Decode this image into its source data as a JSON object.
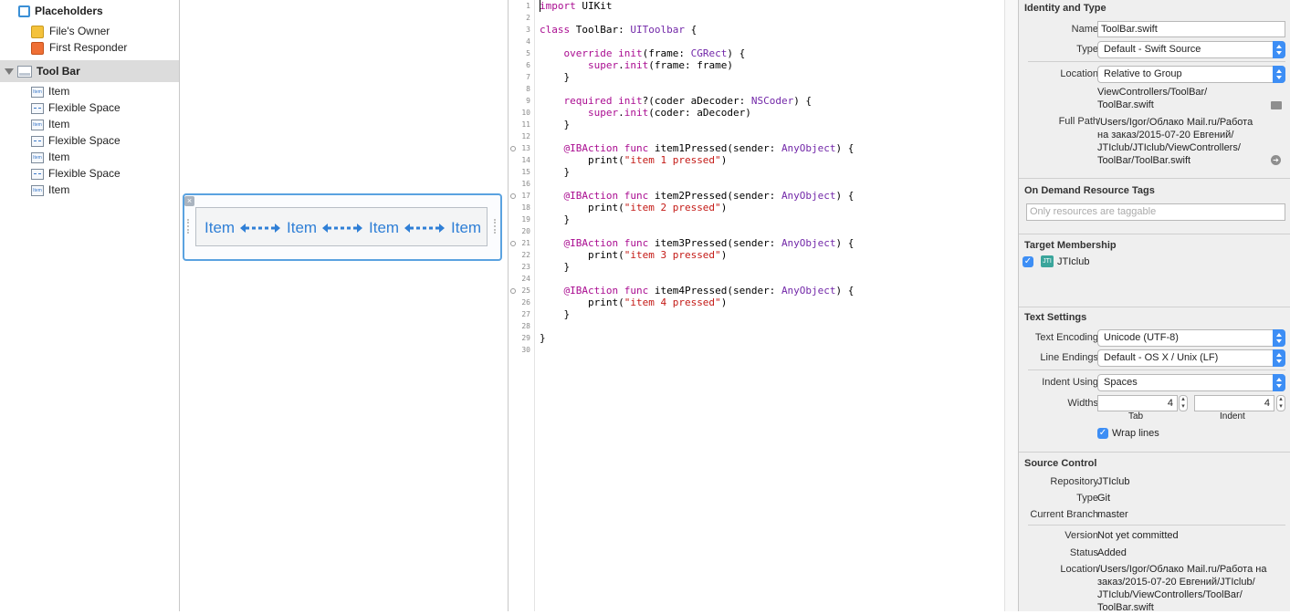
{
  "outline": {
    "placeholders_label": "Placeholders",
    "files_owner_label": "File's Owner",
    "first_responder_label": "First Responder",
    "toolbar_label": "Tool Bar",
    "children": [
      {
        "kind": "item",
        "label": "Item"
      },
      {
        "kind": "flex",
        "label": "Flexible Space"
      },
      {
        "kind": "item",
        "label": "Item"
      },
      {
        "kind": "flex",
        "label": "Flexible Space"
      },
      {
        "kind": "item",
        "label": "Item"
      },
      {
        "kind": "flex",
        "label": "Flexible Space"
      },
      {
        "kind": "item",
        "label": "Item"
      }
    ],
    "item_icon_text": "Item"
  },
  "canvas": {
    "items": [
      "Item",
      "Item",
      "Item",
      "Item"
    ],
    "close_glyph": "×"
  },
  "editor": {
    "line_numbers": [
      "1",
      "2",
      "3",
      "4",
      "5",
      "6",
      "7",
      "8",
      "9",
      "10",
      "11",
      "12",
      "13",
      "14",
      "15",
      "16",
      "17",
      "18",
      "19",
      "20",
      "21",
      "22",
      "23",
      "24",
      "25",
      "26",
      "27",
      "28",
      "29",
      "30"
    ],
    "breakpoint_lines": [
      13,
      17,
      21,
      25
    ],
    "lines": [
      [
        {
          "t": "import",
          "c": "kw"
        },
        {
          "t": " UIKit"
        }
      ],
      [],
      [
        {
          "t": "class",
          "c": "kw"
        },
        {
          "t": " ToolBar: "
        },
        {
          "t": "UIToolbar",
          "c": "ty"
        },
        {
          "t": " {"
        }
      ],
      [],
      [
        {
          "t": "    "
        },
        {
          "t": "override",
          "c": "kw"
        },
        {
          "t": " "
        },
        {
          "t": "init",
          "c": "kw"
        },
        {
          "t": "(frame: "
        },
        {
          "t": "CGRect",
          "c": "ty"
        },
        {
          "t": ") {"
        }
      ],
      [
        {
          "t": "        "
        },
        {
          "t": "super",
          "c": "kw"
        },
        {
          "t": "."
        },
        {
          "t": "init",
          "c": "kw"
        },
        {
          "t": "(frame: frame)"
        }
      ],
      [
        {
          "t": "    }"
        }
      ],
      [],
      [
        {
          "t": "    "
        },
        {
          "t": "required",
          "c": "kw"
        },
        {
          "t": " "
        },
        {
          "t": "init",
          "c": "kw"
        },
        {
          "t": "?(coder aDecoder: "
        },
        {
          "t": "NSCoder",
          "c": "ty"
        },
        {
          "t": ") {"
        }
      ],
      [
        {
          "t": "        "
        },
        {
          "t": "super",
          "c": "kw"
        },
        {
          "t": "."
        },
        {
          "t": "init",
          "c": "kw"
        },
        {
          "t": "(coder: aDecoder)"
        }
      ],
      [
        {
          "t": "    }"
        }
      ],
      [],
      [
        {
          "t": "    "
        },
        {
          "t": "@IBAction",
          "c": "kw"
        },
        {
          "t": " "
        },
        {
          "t": "func",
          "c": "kw"
        },
        {
          "t": " item1Pressed(sender: "
        },
        {
          "t": "AnyObject",
          "c": "ty"
        },
        {
          "t": ") {"
        }
      ],
      [
        {
          "t": "        print("
        },
        {
          "t": "\"item 1 pressed\"",
          "c": "st"
        },
        {
          "t": ")"
        }
      ],
      [
        {
          "t": "    }"
        }
      ],
      [],
      [
        {
          "t": "    "
        },
        {
          "t": "@IBAction",
          "c": "kw"
        },
        {
          "t": " "
        },
        {
          "t": "func",
          "c": "kw"
        },
        {
          "t": " item2Pressed(sender: "
        },
        {
          "t": "AnyObject",
          "c": "ty"
        },
        {
          "t": ") {"
        }
      ],
      [
        {
          "t": "        print("
        },
        {
          "t": "\"item 2 pressed\"",
          "c": "st"
        },
        {
          "t": ")"
        }
      ],
      [
        {
          "t": "    }"
        }
      ],
      [],
      [
        {
          "t": "    "
        },
        {
          "t": "@IBAction",
          "c": "kw"
        },
        {
          "t": " "
        },
        {
          "t": "func",
          "c": "kw"
        },
        {
          "t": " item3Pressed(sender: "
        },
        {
          "t": "AnyObject",
          "c": "ty"
        },
        {
          "t": ") {"
        }
      ],
      [
        {
          "t": "        print("
        },
        {
          "t": "\"item 3 pressed\"",
          "c": "st"
        },
        {
          "t": ")"
        }
      ],
      [
        {
          "t": "    }"
        }
      ],
      [],
      [
        {
          "t": "    "
        },
        {
          "t": "@IBAction",
          "c": "kw"
        },
        {
          "t": " "
        },
        {
          "t": "func",
          "c": "kw"
        },
        {
          "t": " item4Pressed(sender: "
        },
        {
          "t": "AnyObject",
          "c": "ty"
        },
        {
          "t": ") {"
        }
      ],
      [
        {
          "t": "        print("
        },
        {
          "t": "\"item 4 pressed\"",
          "c": "st"
        },
        {
          "t": ")"
        }
      ],
      [
        {
          "t": "    }"
        }
      ],
      [],
      [
        {
          "t": "}"
        }
      ],
      []
    ]
  },
  "inspector": {
    "identity": {
      "title": "Identity and Type",
      "name_label": "Name",
      "name_value": "ToolBar.swift",
      "type_label": "Type",
      "type_value": "Default - Swift Source",
      "location_label": "Location",
      "location_value": "Relative to Group",
      "path_line1": "ViewControllers/ToolBar/",
      "path_line2": "ToolBar.swift",
      "fullpath_label": "Full Path",
      "fullpath_lines": [
        "/Users/Igor/Облако Mail.ru/Работа",
        "на заказ/2015-07-20 Евгений/",
        "JTIclub/JTIclub/ViewControllers/",
        "ToolBar/ToolBar.swift"
      ]
    },
    "on_demand": {
      "title": "On Demand Resource Tags",
      "placeholder": "Only resources are taggable"
    },
    "target": {
      "title": "Target Membership",
      "app_name": "JTIclub",
      "checked_glyph": "✓"
    },
    "text_settings": {
      "title": "Text Settings",
      "encoding_label": "Text Encoding",
      "encoding_value": "Unicode (UTF-8)",
      "endings_label": "Line Endings",
      "endings_value": "Default - OS X / Unix (LF)",
      "indent_label": "Indent Using",
      "indent_value": "Spaces",
      "widths_label": "Widths",
      "tab_value": "4",
      "indent_width_value": "4",
      "tab_caption": "Tab",
      "indent_caption": "Indent",
      "wrap_label": "Wrap lines"
    },
    "source_control": {
      "title": "Source Control",
      "repository_label": "Repository",
      "repository_value": "JTIclub",
      "type_label": "Type",
      "type_value": "Git",
      "branch_label": "Current Branch",
      "branch_value": "master",
      "version_label": "Version",
      "version_value": "Not yet committed",
      "status_label": "Status",
      "status_value": "Added",
      "location_label": "Location",
      "location_lines": [
        "/Users/Igor/Облако Mail.ru/Работа на",
        "заказ/2015-07-20 Евгений/JTIclub/",
        "JTIclub/ViewControllers/ToolBar/",
        "ToolBar.swift"
      ]
    }
  }
}
